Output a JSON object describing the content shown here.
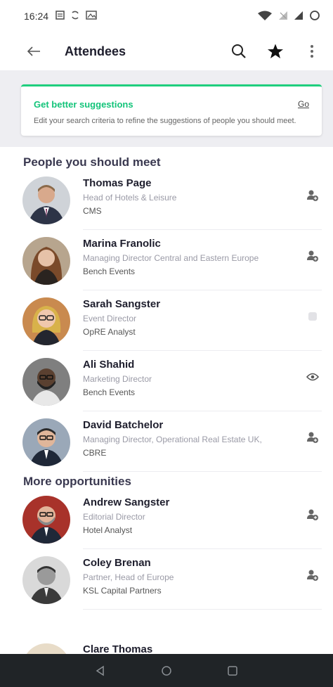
{
  "status_bar": {
    "time": "16:24"
  },
  "app_bar": {
    "title": "Attendees"
  },
  "banner": {
    "title": "Get better suggestions",
    "action": "Go",
    "text": "Edit your search criteria to refine the suggestions of people you should meet."
  },
  "sections": {
    "people_title": "People you should meet",
    "more_title": "More opportunities"
  },
  "people": [
    {
      "name": "Thomas Page",
      "role": "Head of Hotels & Leisure",
      "company": "CMS",
      "action_icon": "add-contact-icon"
    },
    {
      "name": "Marina Franolic",
      "role": "Managing Director Central and Eastern Europe",
      "company": "Bench Events",
      "action_icon": "add-contact-icon"
    },
    {
      "name": "Sarah Sangster",
      "role": "Event Director",
      "company": "OpRE Analyst",
      "action_icon": "pending-icon"
    },
    {
      "name": "Ali Shahid",
      "role": "Marketing Director",
      "company": "Bench Events",
      "action_icon": "eye-icon"
    },
    {
      "name": "David Batchelor",
      "role": "Managing Director, Operational Real Estate UK,",
      "company": "CBRE",
      "action_icon": "add-contact-icon"
    }
  ],
  "more": [
    {
      "name": "Andrew Sangster",
      "role": "Editorial Director",
      "company": "Hotel Analyst",
      "action_icon": "add-contact-icon"
    },
    {
      "name": "Coley Brenan",
      "role": "Partner, Head of Europe",
      "company": "KSL Capital Partners",
      "action_icon": "add-contact-icon"
    },
    {
      "name": "Clare Thomas",
      "role": "",
      "company": "",
      "action_icon": ""
    }
  ],
  "colors": {
    "accent": "#1fcf7e",
    "nav_bar": "#202427",
    "background_band": "#eeeef2"
  }
}
